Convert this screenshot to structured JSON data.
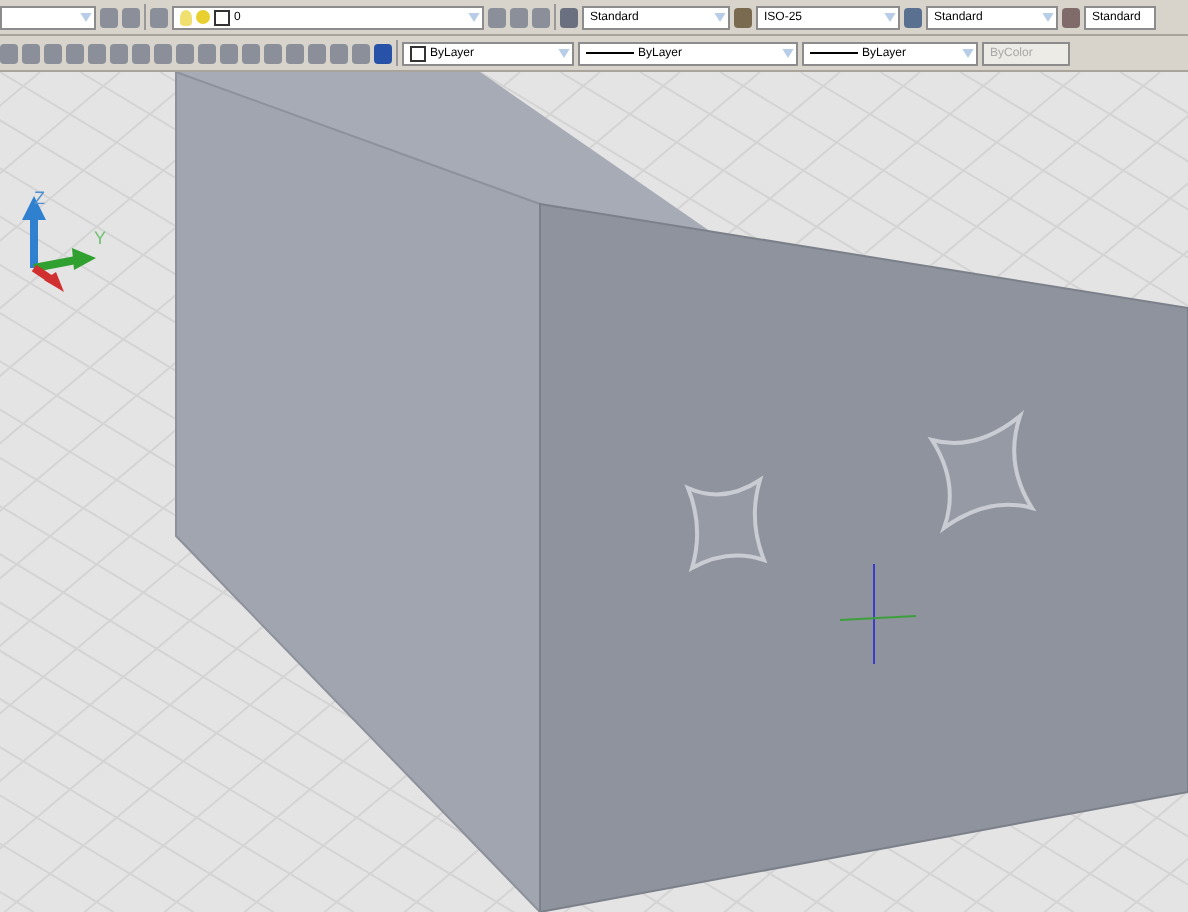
{
  "toolbar_top": {
    "layer": {
      "value": "0"
    },
    "styles": [
      {
        "kind": "text",
        "value": "Standard"
      },
      {
        "kind": "dimension",
        "value": "ISO-25"
      },
      {
        "kind": "table",
        "value": "Standard"
      },
      {
        "kind": "multileader",
        "value": "Standard"
      }
    ]
  },
  "properties_bar": [
    {
      "kind": "color",
      "value": "ByLayer",
      "disabled": false
    },
    {
      "kind": "linetype",
      "value": "ByLayer",
      "disabled": false
    },
    {
      "kind": "lineweight",
      "value": "ByLayer",
      "disabled": false
    },
    {
      "kind": "plotstyle",
      "value": "ByColor",
      "disabled": true
    }
  ],
  "ucs": {
    "z_label": "Z",
    "y_label": "Y"
  }
}
